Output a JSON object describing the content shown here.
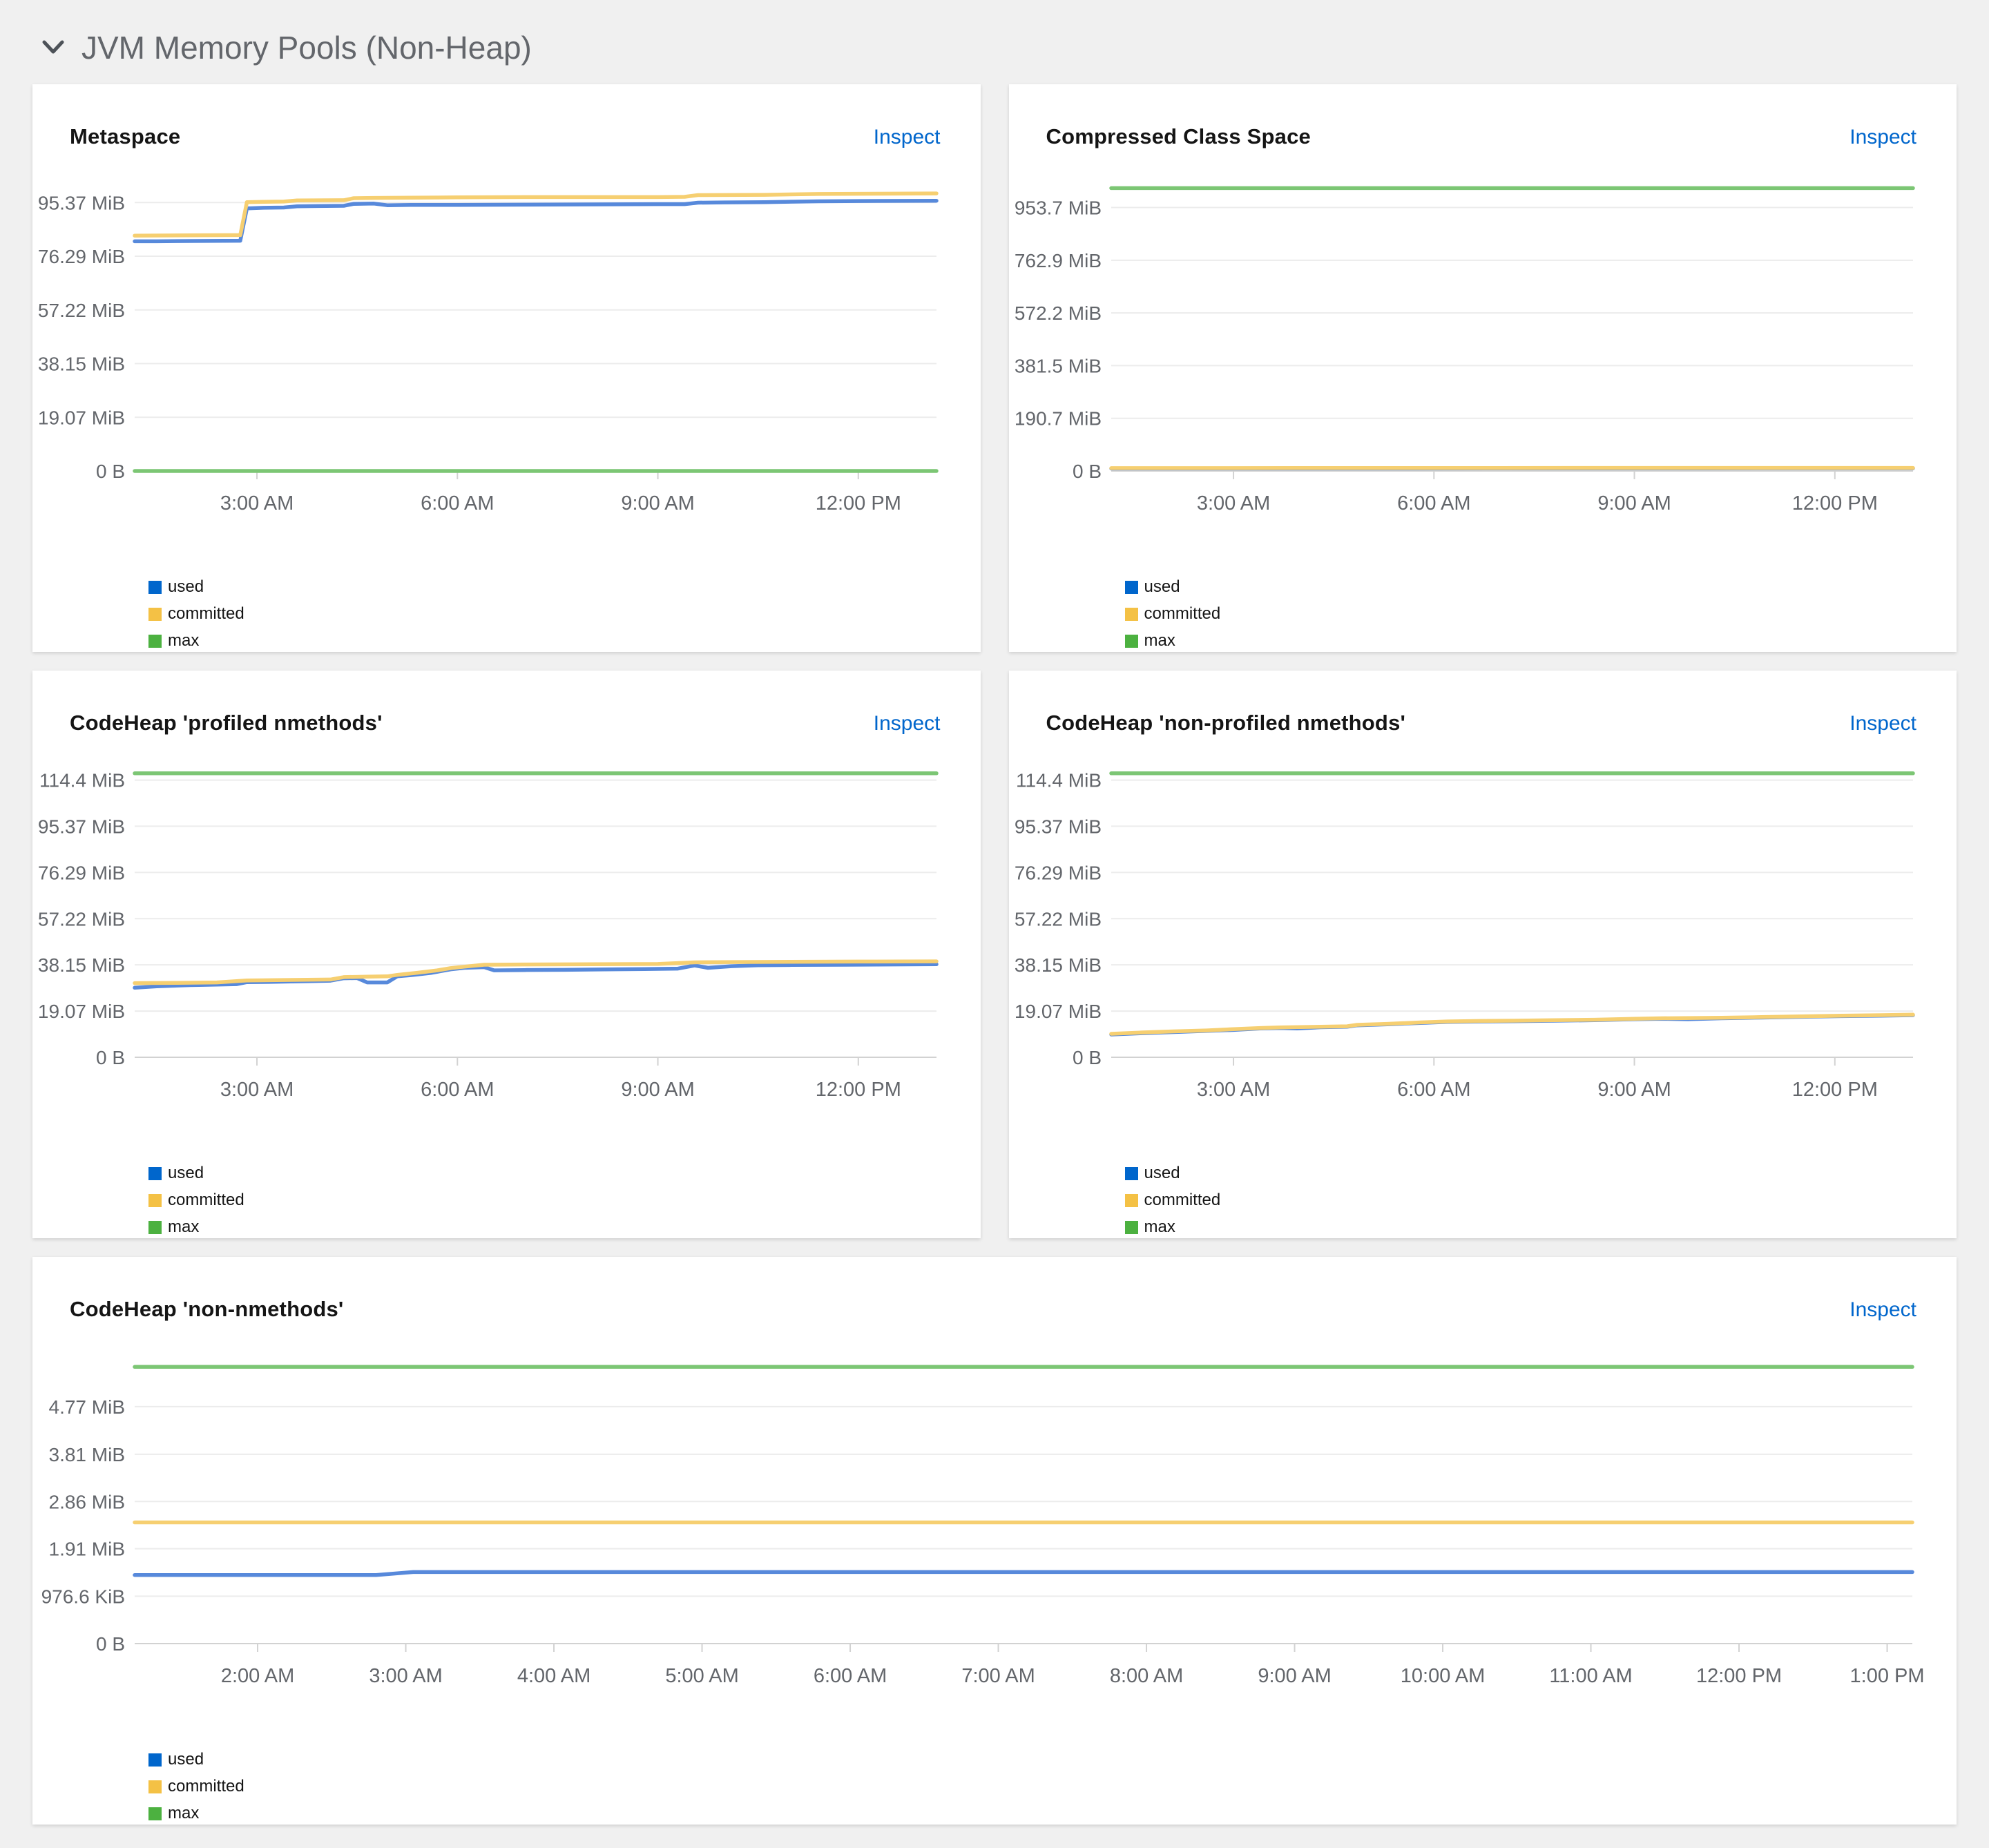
{
  "section": {
    "title": "JVM Memory Pools (Non-Heap)"
  },
  "legend": {
    "items": [
      {
        "label": "used",
        "color": "#0066CC"
      },
      {
        "label": "committed",
        "color": "#F4C145"
      },
      {
        "label": "max",
        "color": "#4CB140"
      }
    ]
  },
  "series_styles": {
    "used": {
      "line": "#5789DB"
    },
    "committed": {
      "line": "#F6CF71"
    },
    "max": {
      "line": "#7CC674"
    }
  },
  "axis_colors": {
    "grid": "#ececec",
    "domain": "#d2d2d2",
    "tick": "#d2d2d2",
    "label": "#63666b"
  },
  "chart_data": [
    {
      "type": "line",
      "title": "Metaspace",
      "action": "Inspect",
      "xlabel": "",
      "ylabel": "",
      "x_range": [
        1.17,
        13.17
      ],
      "x_ticks": [
        {
          "t": 3,
          "label": "3:00 AM"
        },
        {
          "t": 6,
          "label": "6:00 AM"
        },
        {
          "t": 9,
          "label": "9:00 AM"
        },
        {
          "t": 12,
          "label": "12:00 PM"
        }
      ],
      "y_unit": "MiB",
      "y_ticks": [
        {
          "v": 0,
          "label": "0 B"
        },
        {
          "v": 19.07,
          "label": "19.07 MiB"
        },
        {
          "v": 38.15,
          "label": "38.15 MiB"
        },
        {
          "v": 57.22,
          "label": "57.22 MiB"
        },
        {
          "v": 76.29,
          "label": "76.29 MiB"
        },
        {
          "v": 95.37,
          "label": "95.37 MiB"
        }
      ],
      "y_plot_max": 105,
      "series": [
        {
          "name": "used",
          "points": [
            [
              1.17,
              81.6
            ],
            [
              1.5,
              81.6
            ],
            [
              2.0,
              81.7
            ],
            [
              2.75,
              81.8
            ],
            [
              2.85,
              93.3
            ],
            [
              3.1,
              93.5
            ],
            [
              3.4,
              93.6
            ],
            [
              3.6,
              94.0
            ],
            [
              3.9,
              94.1
            ],
            [
              4.3,
              94.2
            ],
            [
              4.45,
              94.9
            ],
            [
              4.75,
              95.0
            ],
            [
              4.95,
              94.4
            ],
            [
              5.3,
              94.5
            ],
            [
              6.0,
              94.5
            ],
            [
              7.0,
              94.6
            ],
            [
              8.0,
              94.7
            ],
            [
              9.0,
              94.8
            ],
            [
              9.4,
              94.8
            ],
            [
              9.6,
              95.3
            ],
            [
              10.0,
              95.4
            ],
            [
              10.6,
              95.5
            ],
            [
              11.4,
              95.8
            ],
            [
              12.0,
              95.9
            ],
            [
              13.17,
              96.0
            ]
          ]
        },
        {
          "name": "committed",
          "points": [
            [
              1.17,
              83.6
            ],
            [
              2.0,
              83.7
            ],
            [
              2.75,
              83.8
            ],
            [
              2.85,
              95.5
            ],
            [
              3.1,
              95.6
            ],
            [
              3.4,
              95.7
            ],
            [
              3.6,
              96.1
            ],
            [
              4.3,
              96.2
            ],
            [
              4.45,
              96.9
            ],
            [
              4.75,
              97.0
            ],
            [
              5.3,
              97.1
            ],
            [
              6.0,
              97.2
            ],
            [
              7.0,
              97.3
            ],
            [
              9.0,
              97.3
            ],
            [
              9.4,
              97.4
            ],
            [
              9.6,
              98.0
            ],
            [
              10.6,
              98.1
            ],
            [
              11.4,
              98.4
            ],
            [
              12.3,
              98.5
            ],
            [
              13.17,
              98.6
            ]
          ]
        },
        {
          "name": "max",
          "points": [
            [
              1.17,
              0
            ],
            [
              13.17,
              0
            ]
          ]
        }
      ]
    },
    {
      "type": "line",
      "title": "Compressed Class Space",
      "action": "Inspect",
      "xlabel": "",
      "ylabel": "",
      "x_range": [
        1.17,
        13.17
      ],
      "x_ticks": [
        {
          "t": 3,
          "label": "3:00 AM"
        },
        {
          "t": 6,
          "label": "6:00 AM"
        },
        {
          "t": 9,
          "label": "9:00 AM"
        },
        {
          "t": 12,
          "label": "12:00 PM"
        }
      ],
      "y_unit": "MiB",
      "y_ticks": [
        {
          "v": 0,
          "label": "0 B"
        },
        {
          "v": 190.7,
          "label": "190.7 MiB"
        },
        {
          "v": 381.5,
          "label": "381.5 MiB"
        },
        {
          "v": 572.2,
          "label": "572.2 MiB"
        },
        {
          "v": 762.9,
          "label": "762.9 MiB"
        },
        {
          "v": 953.7,
          "label": "953.7 MiB"
        }
      ],
      "y_plot_max": 1070,
      "series": [
        {
          "name": "used",
          "points": [
            [
              1.17,
              8.9
            ],
            [
              4,
              9.1
            ],
            [
              7,
              9.3
            ],
            [
              10,
              9.5
            ],
            [
              13.17,
              9.7
            ]
          ]
        },
        {
          "name": "committed",
          "points": [
            [
              1.17,
              10.3
            ],
            [
              4,
              10.5
            ],
            [
              7,
              10.7
            ],
            [
              10,
              10.9
            ],
            [
              13.17,
              11.1
            ]
          ]
        },
        {
          "name": "max",
          "points": [
            [
              1.17,
              1024
            ],
            [
              13.17,
              1024
            ]
          ]
        }
      ]
    },
    {
      "type": "line",
      "title": "CodeHeap 'profiled nmethods'",
      "action": "Inspect",
      "xlabel": "",
      "ylabel": "",
      "x_range": [
        1.17,
        13.17
      ],
      "x_ticks": [
        {
          "t": 3,
          "label": "3:00 AM"
        },
        {
          "t": 6,
          "label": "6:00 AM"
        },
        {
          "t": 9,
          "label": "9:00 AM"
        },
        {
          "t": 12,
          "label": "12:00 PM"
        }
      ],
      "y_unit": "MiB",
      "y_ticks": [
        {
          "v": 0,
          "label": "0 B"
        },
        {
          "v": 19.07,
          "label": "19.07 MiB"
        },
        {
          "v": 38.15,
          "label": "38.15 MiB"
        },
        {
          "v": 57.22,
          "label": "57.22 MiB"
        },
        {
          "v": 76.29,
          "label": "76.29 MiB"
        },
        {
          "v": 95.37,
          "label": "95.37 MiB"
        },
        {
          "v": 114.4,
          "label": "114.4 MiB"
        }
      ],
      "y_plot_max": 122,
      "series": [
        {
          "name": "used",
          "points": [
            [
              1.17,
              28.7
            ],
            [
              1.5,
              29.3
            ],
            [
              2.0,
              29.8
            ],
            [
              2.4,
              30.0
            ],
            [
              2.7,
              30.2
            ],
            [
              2.85,
              31.0
            ],
            [
              3.2,
              31.1
            ],
            [
              3.5,
              31.3
            ],
            [
              3.8,
              31.4
            ],
            [
              4.1,
              31.6
            ],
            [
              4.3,
              32.6
            ],
            [
              4.5,
              32.7
            ],
            [
              4.65,
              30.9
            ],
            [
              4.95,
              30.9
            ],
            [
              5.1,
              33.4
            ],
            [
              5.3,
              33.9
            ],
            [
              5.6,
              34.8
            ],
            [
              5.9,
              36.3
            ],
            [
              6.1,
              36.9
            ],
            [
              6.4,
              37.2
            ],
            [
              6.55,
              35.9
            ],
            [
              7.0,
              36.0
            ],
            [
              7.6,
              36.1
            ],
            [
              8.2,
              36.3
            ],
            [
              8.8,
              36.4
            ],
            [
              9.3,
              36.6
            ],
            [
              9.55,
              37.9
            ],
            [
              9.75,
              36.9
            ],
            [
              10.1,
              37.6
            ],
            [
              10.5,
              38.0
            ],
            [
              11.0,
              38.1
            ],
            [
              11.8,
              38.2
            ],
            [
              12.5,
              38.3
            ],
            [
              13.17,
              38.4
            ]
          ]
        },
        {
          "name": "committed",
          "points": [
            [
              1.17,
              30.6
            ],
            [
              1.8,
              30.7
            ],
            [
              2.4,
              30.9
            ],
            [
              2.85,
              31.7
            ],
            [
              3.4,
              31.9
            ],
            [
              4.1,
              32.1
            ],
            [
              4.3,
              33.1
            ],
            [
              4.65,
              33.3
            ],
            [
              4.95,
              33.4
            ],
            [
              5.1,
              34.0
            ],
            [
              5.4,
              34.9
            ],
            [
              5.7,
              35.9
            ],
            [
              5.9,
              36.8
            ],
            [
              6.1,
              37.4
            ],
            [
              6.4,
              38.2
            ],
            [
              7.0,
              38.3
            ],
            [
              8.0,
              38.4
            ],
            [
              9.0,
              38.5
            ],
            [
              9.55,
              39.2
            ],
            [
              10.1,
              39.3
            ],
            [
              11.0,
              39.4
            ],
            [
              12.0,
              39.5
            ],
            [
              13.17,
              39.6
            ]
          ]
        },
        {
          "name": "max",
          "points": [
            [
              1.17,
              117.2
            ],
            [
              13.17,
              117.2
            ]
          ]
        }
      ]
    },
    {
      "type": "line",
      "title": "CodeHeap 'non-profiled nmethods'",
      "action": "Inspect",
      "xlabel": "",
      "ylabel": "",
      "x_range": [
        1.17,
        13.17
      ],
      "x_ticks": [
        {
          "t": 3,
          "label": "3:00 AM"
        },
        {
          "t": 6,
          "label": "6:00 AM"
        },
        {
          "t": 9,
          "label": "9:00 AM"
        },
        {
          "t": 12,
          "label": "12:00 PM"
        }
      ],
      "y_unit": "MiB",
      "y_ticks": [
        {
          "v": 0,
          "label": "0 B"
        },
        {
          "v": 19.07,
          "label": "19.07 MiB"
        },
        {
          "v": 38.15,
          "label": "38.15 MiB"
        },
        {
          "v": 57.22,
          "label": "57.22 MiB"
        },
        {
          "v": 76.29,
          "label": "76.29 MiB"
        },
        {
          "v": 95.37,
          "label": "95.37 MiB"
        },
        {
          "v": 114.4,
          "label": "114.4 MiB"
        }
      ],
      "y_plot_max": 122,
      "series": [
        {
          "name": "used",
          "points": [
            [
              1.17,
              9.4
            ],
            [
              1.6,
              9.9
            ],
            [
              2.1,
              10.4
            ],
            [
              2.6,
              10.9
            ],
            [
              3.0,
              11.3
            ],
            [
              3.4,
              11.9
            ],
            [
              3.7,
              12.1
            ],
            [
              3.95,
              11.9
            ],
            [
              4.3,
              12.4
            ],
            [
              4.7,
              12.6
            ],
            [
              4.85,
              13.2
            ],
            [
              5.3,
              13.6
            ],
            [
              5.8,
              14.2
            ],
            [
              6.2,
              14.6
            ],
            [
              6.7,
              14.8
            ],
            [
              7.2,
              14.9
            ],
            [
              7.8,
              15.1
            ],
            [
              8.4,
              15.3
            ],
            [
              9.0,
              15.7
            ],
            [
              9.4,
              15.9
            ],
            [
              9.8,
              15.7
            ],
            [
              10.3,
              16.1
            ],
            [
              10.9,
              16.4
            ],
            [
              11.5,
              16.7
            ],
            [
              12.1,
              17.0
            ],
            [
              12.7,
              17.2
            ],
            [
              13.17,
              17.4
            ]
          ]
        },
        {
          "name": "committed",
          "points": [
            [
              1.17,
              9.7
            ],
            [
              1.6,
              10.2
            ],
            [
              2.1,
              10.7
            ],
            [
              2.6,
              11.1
            ],
            [
              3.0,
              11.6
            ],
            [
              3.4,
              12.1
            ],
            [
              3.7,
              12.3
            ],
            [
              4.3,
              12.6
            ],
            [
              4.7,
              12.8
            ],
            [
              4.85,
              13.4
            ],
            [
              5.3,
              13.8
            ],
            [
              5.8,
              14.4
            ],
            [
              6.2,
              14.8
            ],
            [
              6.7,
              15.0
            ],
            [
              7.2,
              15.1
            ],
            [
              7.8,
              15.3
            ],
            [
              8.4,
              15.5
            ],
            [
              9.0,
              15.9
            ],
            [
              9.4,
              16.1
            ],
            [
              10.3,
              16.3
            ],
            [
              10.9,
              16.6
            ],
            [
              11.5,
              16.9
            ],
            [
              12.1,
              17.2
            ],
            [
              12.7,
              17.4
            ],
            [
              13.17,
              17.6
            ]
          ]
        },
        {
          "name": "max",
          "points": [
            [
              1.17,
              117.2
            ],
            [
              13.17,
              117.2
            ]
          ]
        }
      ]
    },
    {
      "type": "line",
      "title": "CodeHeap 'non-nmethods'",
      "action": "Inspect",
      "xlabel": "",
      "ylabel": "",
      "x_range": [
        1.17,
        13.17
      ],
      "x_ticks": [
        {
          "t": 2,
          "label": "2:00 AM"
        },
        {
          "t": 3,
          "label": "3:00 AM"
        },
        {
          "t": 4,
          "label": "4:00 AM"
        },
        {
          "t": 5,
          "label": "5:00 AM"
        },
        {
          "t": 6,
          "label": "6:00 AM"
        },
        {
          "t": 7,
          "label": "7:00 AM"
        },
        {
          "t": 8,
          "label": "8:00 AM"
        },
        {
          "t": 9,
          "label": "9:00 AM"
        },
        {
          "t": 10,
          "label": "10:00 AM"
        },
        {
          "t": 11,
          "label": "11:00 AM"
        },
        {
          "t": 12,
          "label": "12:00 PM"
        },
        {
          "t": 13,
          "label": "1:00 PM"
        }
      ],
      "y_unit": "MiB",
      "y_ticks": [
        {
          "v": 0,
          "label": "0 B"
        },
        {
          "v": 0.9537,
          "label": "976.6 KiB"
        },
        {
          "v": 1.91,
          "label": "1.91 MiB"
        },
        {
          "v": 2.86,
          "label": "2.86 MiB"
        },
        {
          "v": 3.81,
          "label": "3.81 MiB"
        },
        {
          "v": 4.77,
          "label": "4.77 MiB"
        }
      ],
      "y_plot_max": 5.95,
      "series": [
        {
          "name": "used",
          "points": [
            [
              1.17,
              1.38
            ],
            [
              2.8,
              1.38
            ],
            [
              3.05,
              1.44
            ],
            [
              13.17,
              1.44
            ]
          ]
        },
        {
          "name": "committed",
          "points": [
            [
              1.17,
              2.44
            ],
            [
              13.17,
              2.44
            ]
          ]
        },
        {
          "name": "max",
          "points": [
            [
              1.17,
              5.57
            ],
            [
              13.17,
              5.57
            ]
          ]
        }
      ]
    }
  ]
}
